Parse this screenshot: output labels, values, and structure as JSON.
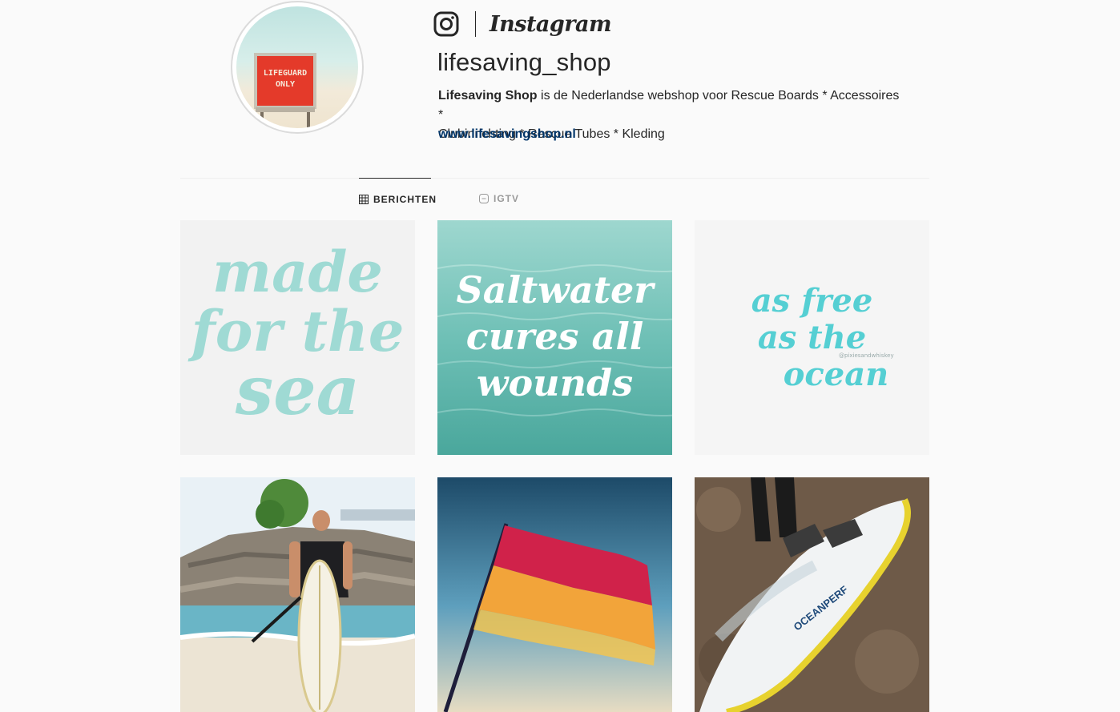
{
  "header": {
    "brand_name": "Instagram",
    "username": "lifesaving_shop",
    "bio_name": "Lifesaving Shop",
    "bio_line1_rest": " is de Nederlandse webshop voor Rescue Boards * Accessoires *",
    "bio_line2": "Clubinrichting * Rescue Tubes * Kleding",
    "website": "www.lifesavingshop.nl",
    "avatar_sign_line1": "LIFEGUARD",
    "avatar_sign_line2": "ONLY"
  },
  "tabs": [
    {
      "label": "BERICHTEN",
      "icon": "grid-icon",
      "active": true
    },
    {
      "label": "IGTV",
      "icon": "igtv-icon",
      "active": false
    }
  ],
  "posts": [
    {
      "id": "post-1",
      "text_lines": [
        "made",
        "for the",
        "sea"
      ],
      "bg": "#f2f2f2",
      "text_color": "#9fdad4"
    },
    {
      "id": "post-2",
      "text_lines": [
        "Saltwater",
        "cures all",
        "wounds"
      ],
      "bg": "#7ec8be",
      "text_color": "#ffffff"
    },
    {
      "id": "post-3",
      "text_lines": [
        "as free",
        "as the",
        "ocean"
      ],
      "bg": "#f5f5f5",
      "text_color": "#55cfd3",
      "small_caption": "@pixiesandwhiskey"
    },
    {
      "id": "post-4",
      "description": "paddleboarder-photo"
    },
    {
      "id": "post-5",
      "description": "lifeguard-flag-photo"
    },
    {
      "id": "post-6",
      "board_text": "OCEANPERF"
    }
  ],
  "colors": {
    "background": "#fafafa",
    "text": "#262626",
    "link": "#003569",
    "muted": "#999999",
    "divider": "#efefef"
  }
}
